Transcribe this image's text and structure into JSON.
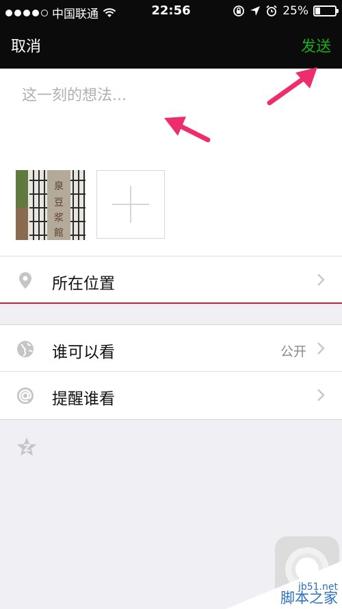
{
  "status_bar": {
    "carrier": "中国联通",
    "time": "22:56",
    "battery": "25%",
    "battery_level": 0.25
  },
  "nav": {
    "cancel_label": "取消",
    "send_label": "发送"
  },
  "compose": {
    "placeholder": "这一刻的想法...",
    "photo_sign": "泉豆浆館"
  },
  "rows": {
    "location_label": "所在位置",
    "visibility_label": "谁可以看",
    "visibility_value": "公开",
    "mention_label": "提醒谁看"
  },
  "icons": {
    "location": "location-pin-icon",
    "visibility": "globe-icon",
    "mention": "at-icon",
    "favorite": "star-icon",
    "chevron": "chevron-right-icon"
  },
  "colors": {
    "nav_bg": "#0b0b0b",
    "send": "#1aad19",
    "annotation_arrow": "#ee2e6c",
    "accent_line": "#d91c3b"
  },
  "watermark": {
    "url": "jb51.net",
    "name": "脚本之家"
  }
}
